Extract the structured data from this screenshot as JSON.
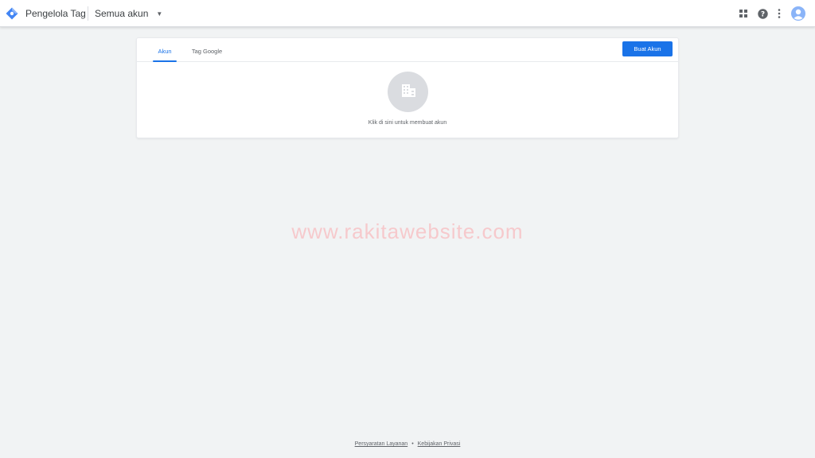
{
  "header": {
    "app_title": "Pengelola Tag",
    "account_selector": "Semua akun",
    "icons": [
      "tag-manager-logo-icon",
      "apps-grid-icon",
      "help-icon",
      "more-vert-icon",
      "account-avatar-icon"
    ]
  },
  "card": {
    "tabs": [
      {
        "label": "Akun",
        "active": true
      },
      {
        "label": "Tag Google",
        "active": false
      }
    ],
    "create_button": "Buat Akun",
    "empty_state_icon": "building-icon",
    "empty_state_text": "Klik di sini untuk membuat akun"
  },
  "watermark": "www.rakitawebsite.com",
  "footer": {
    "terms": "Persyaratan Layanan",
    "separator": "•",
    "privacy": "Kebijakan Privasi"
  },
  "colors": {
    "accent": "#1a73e8",
    "background": "#f1f3f4",
    "watermark": "#f6c9cc"
  }
}
